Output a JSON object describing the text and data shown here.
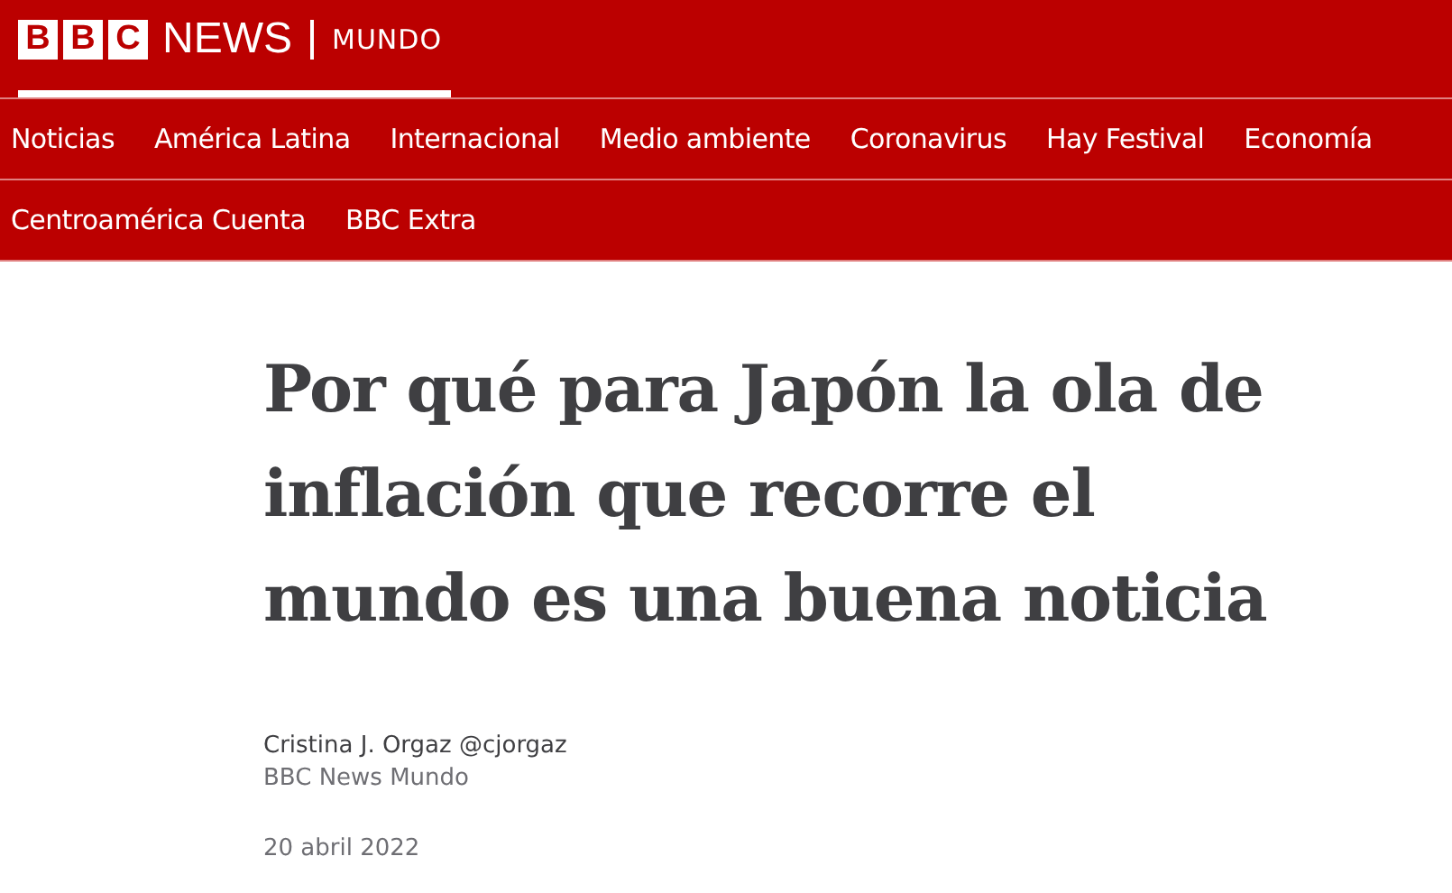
{
  "brand": {
    "logo_letters": [
      "B",
      "B",
      "C"
    ],
    "name": "NEWS",
    "section": "MUNDO",
    "selected": true
  },
  "nav_rows": [
    [
      {
        "label": "Noticias"
      },
      {
        "label": "América Latina"
      },
      {
        "label": "Internacional"
      },
      {
        "label": "Medio ambiente"
      },
      {
        "label": "Coronavirus"
      },
      {
        "label": "Hay Festival"
      },
      {
        "label": "Economía"
      }
    ],
    [
      {
        "label": "Centroamérica Cuenta"
      },
      {
        "label": "BBC Extra"
      }
    ]
  ],
  "article": {
    "headline": "Por qué para Japón la ola de inflación que recorre el mundo es una buena noticia",
    "author": "Cristina J. Orgaz @cjorgaz",
    "outlet": "BBC News Mundo",
    "date": "20 abril 2022"
  }
}
